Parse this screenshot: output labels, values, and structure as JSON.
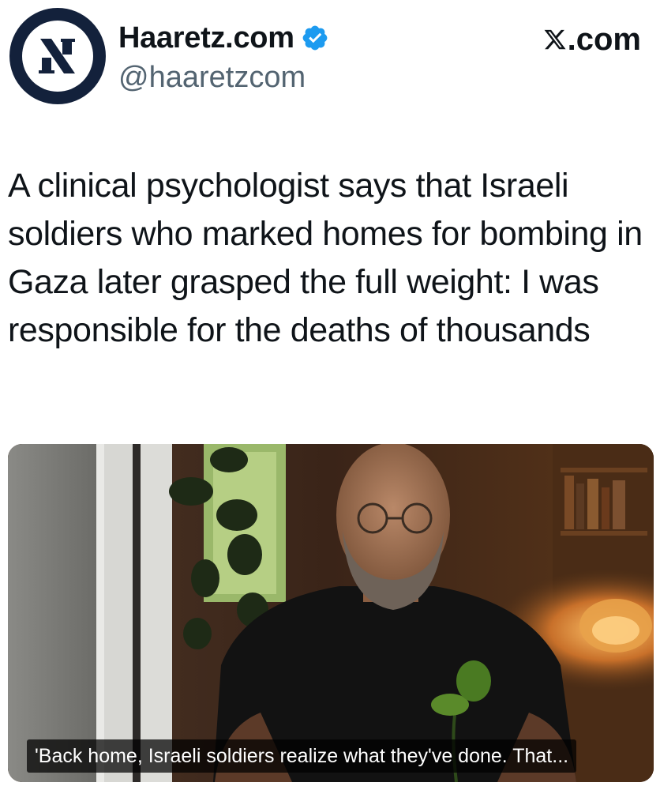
{
  "account": {
    "display_name": "Haaretz.com",
    "handle": "@haaretzcom",
    "avatar_icon": "haaretz-aleph-logo-icon",
    "verified_icon": "verified-badge-icon",
    "verified_color": "#1d9bf0"
  },
  "source": {
    "label_suffix": ".com",
    "icon": "x-logo-icon"
  },
  "tweet": {
    "text": "A clinical psychologist says that Israeli soldiers who marked homes for bombing in Gaza later grasped the full weight: I was responsible for the deaths of thousands"
  },
  "media": {
    "caption": "'Back home, Israeli soldiers realize what they've done. That..."
  },
  "colors": {
    "text_primary": "#0f1419",
    "text_secondary": "#536471",
    "avatar_bg": "#13213b"
  }
}
